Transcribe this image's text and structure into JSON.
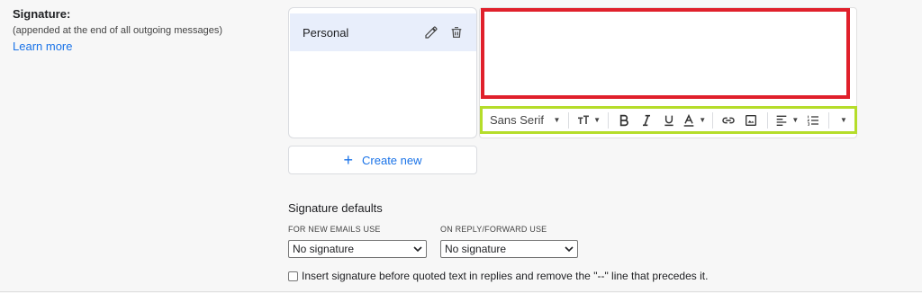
{
  "signature": {
    "title": "Signature:",
    "subtitle": "(appended at the end of all outgoing messages)",
    "learn_more": "Learn more",
    "items": [
      {
        "label": "Personal"
      }
    ],
    "create_new": "Create new"
  },
  "toolbar": {
    "font": "Sans Serif"
  },
  "defaults": {
    "title": "Signature defaults",
    "new_emails_label": "FOR NEW EMAILS USE",
    "new_emails_value": "No signature",
    "reply_label": "ON REPLY/FORWARD USE",
    "reply_value": "No signature",
    "insert_before_quoted": "Insert signature before quoted text in replies and remove the \"--\" line that precedes it.",
    "insert_before_checked": false
  },
  "highlights": {
    "editor_box_color": "#e0202b",
    "toolbar_box_color": "#b5dd2a"
  }
}
